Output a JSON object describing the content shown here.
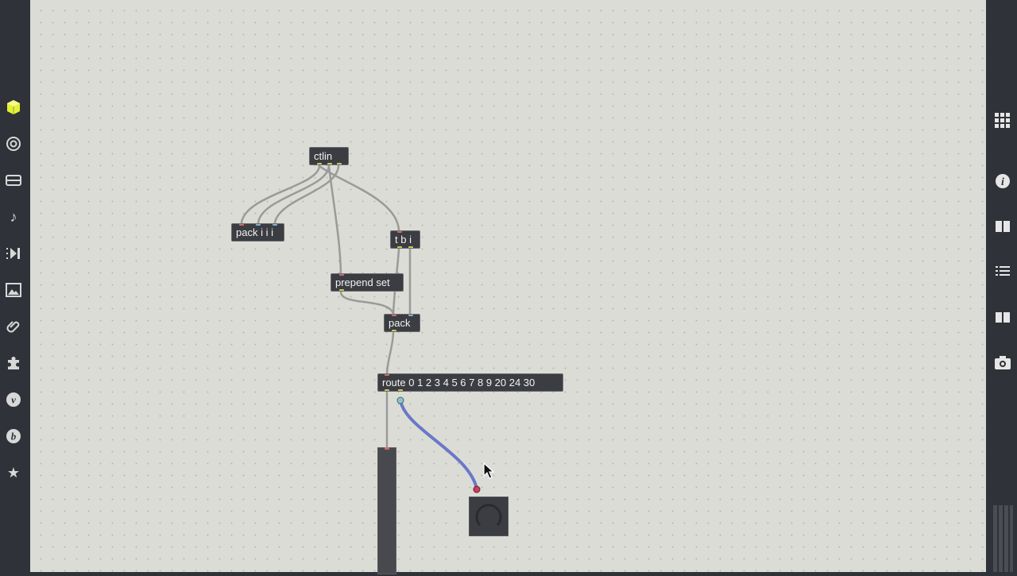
{
  "left_toolbar": {
    "icons": [
      "cube-icon",
      "target-icon",
      "console-icon",
      "music-note-icon",
      "play-step-icon",
      "image-icon",
      "paperclip-icon",
      "puzzle-icon",
      "vimeo-icon",
      "bandcamp-icon",
      "star-icon"
    ]
  },
  "right_toolbar": {
    "icons": [
      "grid-icon",
      "info-icon",
      "split-view-icon",
      "list-icon",
      "book-icon",
      "camera-icon"
    ]
  },
  "objects": {
    "ctlin": "ctlin",
    "pack_iii": "pack i i i",
    "tbi": "t b i",
    "prepend": "prepend set",
    "pack": "pack",
    "route": "route 0 1 2 3 4 5 6 7 8 9 20 24 30"
  },
  "colors": {
    "canvas": "#dcdcd6",
    "object": "#3b3d42",
    "cord": "#9a9a9a",
    "selected_cord": "#6b78c8",
    "toolbar_accent": "#e3f13a"
  }
}
